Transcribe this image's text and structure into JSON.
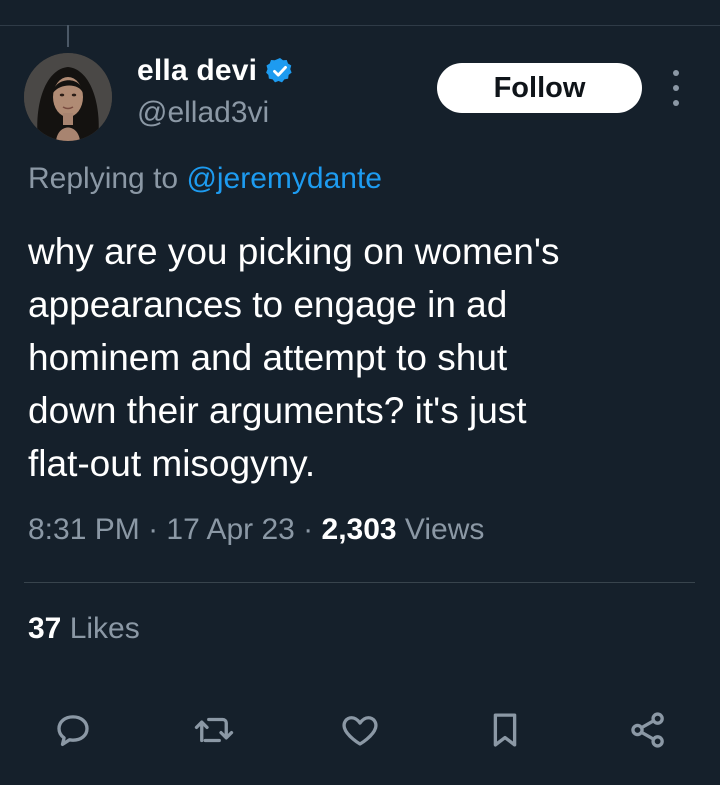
{
  "author": {
    "display_name": "ella devi",
    "handle": "@ellad3vi",
    "verified": true,
    "verified_color": "#1d9bf0"
  },
  "follow_label": "Follow",
  "reply": {
    "prefix": "Replying to ",
    "mention": "@jeremydante"
  },
  "tweet": {
    "text": "why are you picking on women's\nappearances to engage in ad\nhominem and attempt to shut\ndown their arguments? it's just\nflat-out misogyny."
  },
  "meta": {
    "time": "8:31 PM",
    "separator": " · ",
    "date": "17 Apr 23",
    "views_count": "2,303",
    "views_label": " Views"
  },
  "stats": {
    "likes_count": "37",
    "likes_label": " Likes"
  },
  "actions": [
    "reply-icon",
    "retweet-icon",
    "like-icon",
    "bookmark-icon",
    "share-icon"
  ],
  "colors": {
    "background": "#15202b",
    "secondary_text": "#8b98a5",
    "link": "#1d9bf0",
    "divider": "#38444d"
  }
}
